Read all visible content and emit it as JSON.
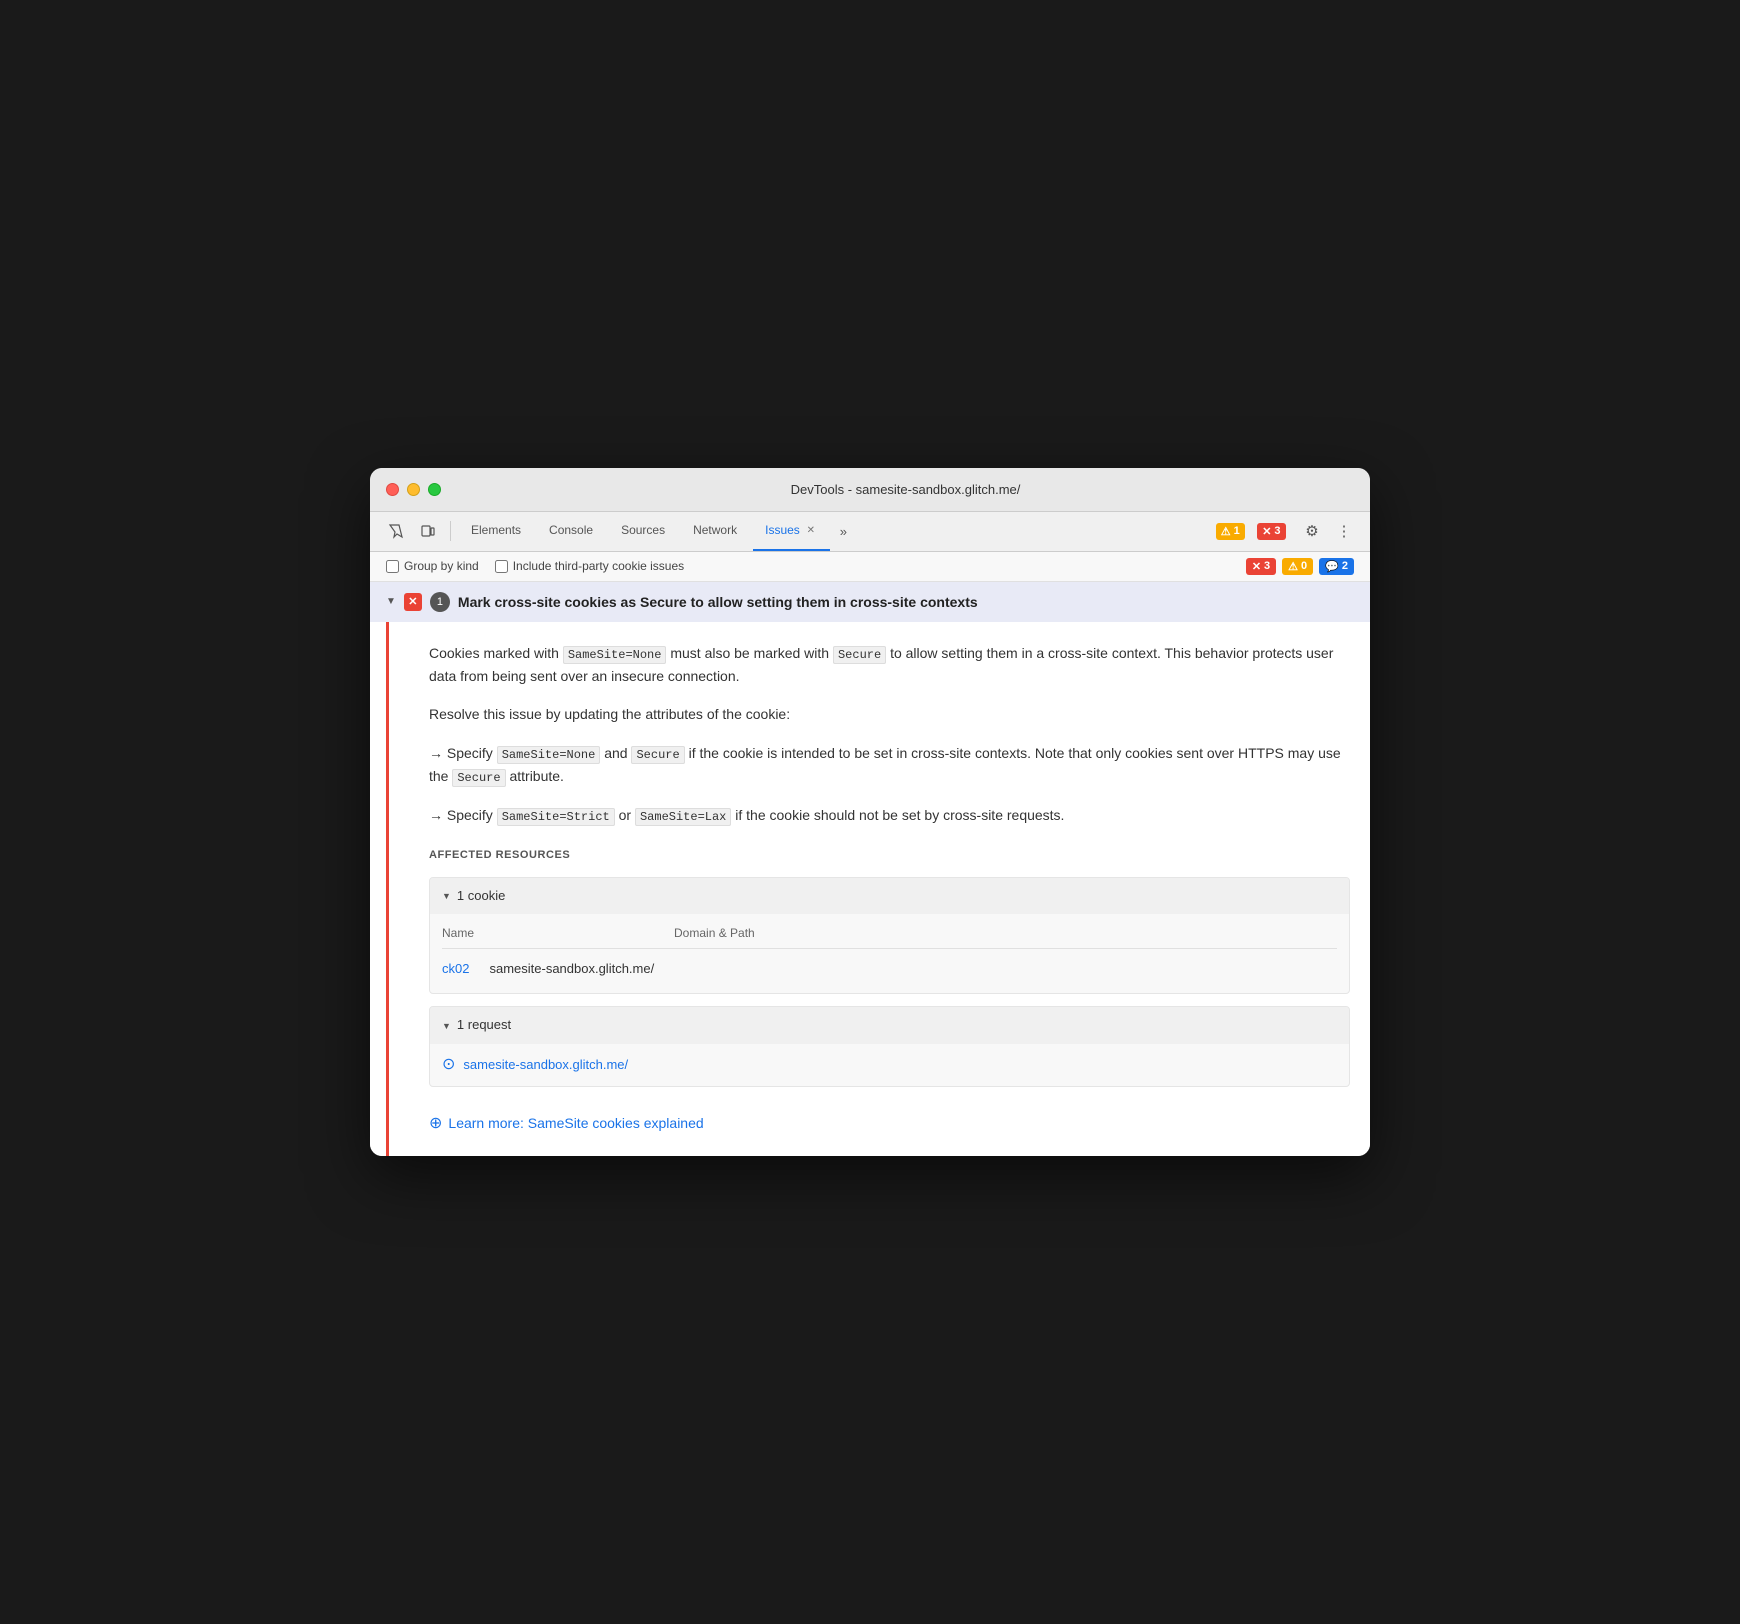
{
  "window": {
    "title": "DevTools - samesite-sandbox.glitch.me/"
  },
  "toolbar": {
    "tabs": [
      {
        "label": "Elements",
        "active": false
      },
      {
        "label": "Console",
        "active": false
      },
      {
        "label": "Sources",
        "active": false
      },
      {
        "label": "Network",
        "active": false
      },
      {
        "label": "Issues",
        "active": true,
        "closeable": true
      }
    ],
    "more_label": "»",
    "warning_count": "1",
    "error_count": "3",
    "inspect_icon": "⬚",
    "device_icon": "☐"
  },
  "filter_bar": {
    "group_by_kind_label": "Group by kind",
    "include_third_party_label": "Include third-party cookie issues",
    "counts": {
      "errors": "3",
      "warnings": "0",
      "info": "2"
    }
  },
  "issue": {
    "badge_icon": "✕",
    "count": "1",
    "title": "Mark cross-site cookies as Secure to allow setting them in cross-site contexts",
    "description_1": "Cookies marked with ",
    "code_1": "SameSite=None",
    "description_2": " must also be marked with ",
    "code_2": "Secure",
    "description_3": " to allow setting them in a cross-site context. This behavior protects user data from being sent over an insecure connection.",
    "resolve_text": "Resolve this issue by updating the attributes of the cookie:",
    "point1_prefix": "→ Specify ",
    "point1_code1": "SameSite=None",
    "point1_mid": " and ",
    "point1_code2": "Secure",
    "point1_suffix": " if the cookie is intended to be set in cross-site contexts. Note that only cookies sent over HTTPS may use the ",
    "point1_code3": "Secure",
    "point1_end": " attribute.",
    "point2_prefix": "→ Specify ",
    "point2_code1": "SameSite=Strict",
    "point2_mid": " or ",
    "point2_code2": "SameSite=Lax",
    "point2_suffix": " if the cookie should not be set by cross-site requests.",
    "affected_resources_label": "AFFECTED RESOURCES",
    "cookie_section": {
      "header": "1 cookie",
      "col_name": "Name",
      "col_domain": "Domain & Path",
      "cookie_name": "ck02",
      "cookie_domain": "samesite-sandbox.glitch.me/"
    },
    "request_section": {
      "header": "1 request",
      "url": "samesite-sandbox.glitch.me/"
    },
    "learn_more": {
      "label": "Learn more: SameSite cookies explained",
      "url": "#"
    }
  }
}
